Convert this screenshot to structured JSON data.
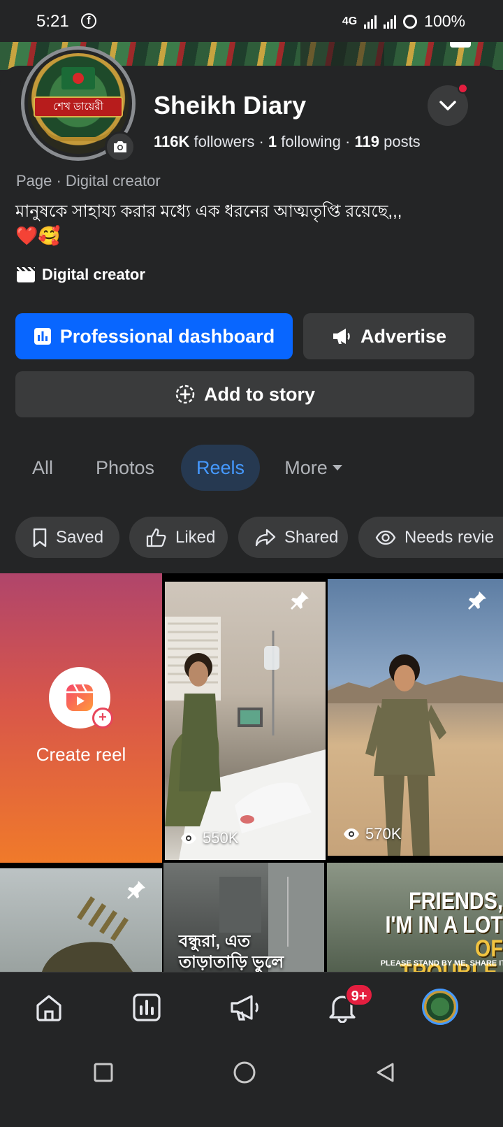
{
  "status_bar": {
    "time": "5:21",
    "network": "4G",
    "battery": "100%"
  },
  "profile": {
    "name": "Sheikh Diary",
    "avatar_text": "শেখ ডায়েরী",
    "followers_count": "116K",
    "followers_label": "followers",
    "following_count": "1",
    "following_label": "following",
    "posts_count": "119",
    "posts_label": "posts",
    "category_line": "Page · Digital creator",
    "bio": "মানুষকে সাহায্য করার মধ্যে এক ধরনের আত্মতৃপ্তি রয়েছে,,,",
    "bio_emoji": "❤️🥰",
    "creator_label": "Digital creator"
  },
  "actions": {
    "dashboard_label": "Professional dashboard",
    "advertise_label": "Advertise",
    "story_label": "Add to story"
  },
  "tabs": [
    {
      "label": "All"
    },
    {
      "label": "Photos"
    },
    {
      "label": "Reels",
      "active": true
    },
    {
      "label": "More"
    }
  ],
  "filters": [
    {
      "label": "Saved",
      "icon": "bookmark-icon"
    },
    {
      "label": "Liked",
      "icon": "thumbs-up-icon"
    },
    {
      "label": "Shared",
      "icon": "share-arrow-icon"
    },
    {
      "label": "Needs revie",
      "icon": "eye-icon"
    }
  ],
  "reels": {
    "create_label": "Create reel",
    "items": [
      {
        "views": "550K",
        "pinned": true
      },
      {
        "views": "570K",
        "pinned": true
      },
      {
        "pinned": true
      },
      {
        "caption": "বন্ধুরা, এত তাড়াতাড়ি ভুলে গেলে আমাকে."
      },
      {
        "caption_line1": "FRIENDS,",
        "caption_line2": "I'M IN A LOT",
        "caption_line3_prefix": "OF ",
        "caption_line3_highlight": "TROUBLE,",
        "caption_small": "PLEASE STAND BY ME, SHARE IT"
      }
    ]
  },
  "bottom_nav": {
    "notification_badge": "9+"
  },
  "colors": {
    "primary_blue": "#0866ff",
    "active_tab_bg": "#263951",
    "active_tab_text": "#4599ff",
    "badge_red": "#e41e3f"
  }
}
